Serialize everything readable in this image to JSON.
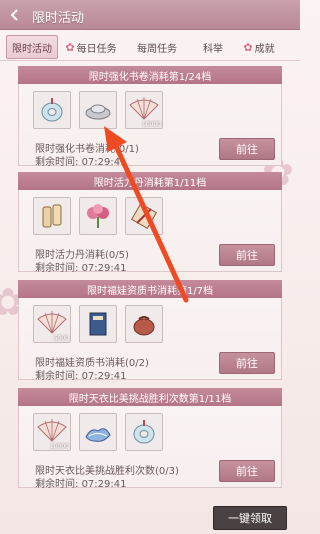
{
  "window": {
    "title": "限时活动"
  },
  "tabs": [
    {
      "label": "限时活动",
      "active": true
    },
    {
      "label": "每日任务",
      "active": false
    },
    {
      "label": "每周任务",
      "active": false
    },
    {
      "label": "科举",
      "active": false
    },
    {
      "label": "成就",
      "active": false
    }
  ],
  "cards": [
    {
      "header": "限时强化书卷消耗第1/24档",
      "items": [
        {
          "icon": "jade-pendant-icon",
          "count": ""
        },
        {
          "icon": "silver-ingot-icon",
          "count": ""
        },
        {
          "icon": "folding-fan-icon",
          "count": "10000"
        }
      ],
      "task": "限时强化书卷消耗(0/1)",
      "timer_label": "剩余时间:",
      "timer_value": "07:29:41",
      "button": "前往"
    },
    {
      "header": "限时活力丹消耗第1/11档",
      "items": [
        {
          "icon": "scroll-bundle-icon",
          "count": ""
        },
        {
          "icon": "flower-bouquet-icon",
          "count": ""
        },
        {
          "icon": "document-scroll-icon",
          "count": ""
        }
      ],
      "task": "限时活力丹消耗(0/5)",
      "timer_label": "剩余时间:",
      "timer_value": "07:29:41",
      "button": "前往"
    },
    {
      "header": "限时福娃资质书消耗第1/7档",
      "items": [
        {
          "icon": "folding-fan-icon",
          "count": "5000"
        },
        {
          "icon": "book-icon",
          "count": ""
        },
        {
          "icon": "pouch-icon",
          "count": ""
        }
      ],
      "task": "限时福娃资质书消耗(0/2)",
      "timer_label": "剩余时间:",
      "timer_value": "07:29:41",
      "button": "前往"
    },
    {
      "header": "限时天衣比美挑战胜利次数第1/11档",
      "items": [
        {
          "icon": "folding-fan-icon",
          "count": "10000"
        },
        {
          "icon": "cloud-dress-icon",
          "count": ""
        },
        {
          "icon": "jade-pendant-icon",
          "count": ""
        }
      ],
      "task": "限时天衣比美挑战胜利次数(0/3)",
      "timer_label": "剩余时间:",
      "timer_value": "07:29:41",
      "button": "前往"
    }
  ],
  "footer": {
    "claim_all": "一键领取"
  },
  "colors": {
    "accent": "#b98995",
    "arrow": "#f04a23"
  }
}
